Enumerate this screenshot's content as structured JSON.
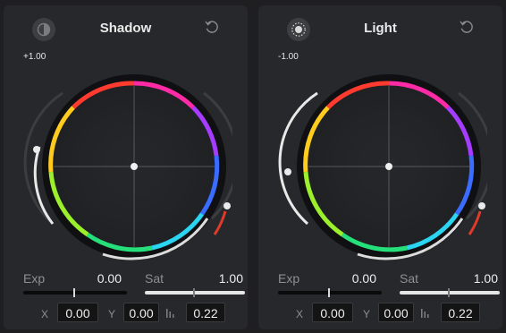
{
  "panels": [
    {
      "title": "Shadow",
      "mode_value": "+1.00",
      "exp_label": "Exp",
      "exp_value": "0.00",
      "exp_level": 0.5,
      "sat_label": "Sat",
      "sat_value": "1.00",
      "sat_level": 0.5,
      "x_label": "X",
      "x_value": "0.00",
      "y_label": "Y",
      "y_value": "0.00",
      "lum_value": "0.22"
    },
    {
      "title": "Light",
      "mode_value": "-1.00",
      "exp_label": "Exp",
      "exp_value": "0.00",
      "exp_level": 0.5,
      "sat_label": "Sat",
      "sat_value": "1.00",
      "sat_level": 0.5,
      "x_label": "X",
      "x_value": "0.00",
      "y_label": "Y",
      "y_value": "0.00",
      "lum_value": "0.22"
    }
  ],
  "icons": {
    "mode_left": "half-moon-icon",
    "mode_right": "sun-icon",
    "reset": "reset-icon",
    "luminance": "luminance-bars-icon"
  },
  "colors": {
    "panel_bg": "#27282b",
    "accent_red": "#e03a2a",
    "track_white": "#e6e6e6"
  }
}
